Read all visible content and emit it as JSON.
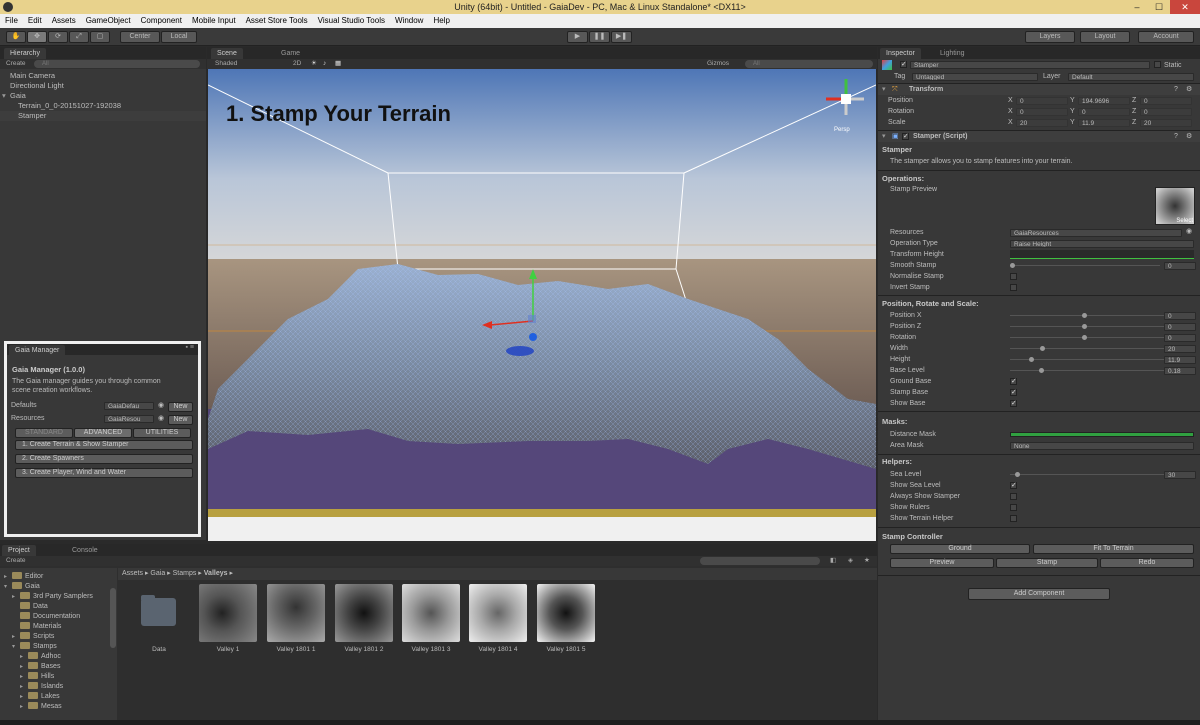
{
  "window": {
    "title": "Unity (64bit) - Untitled - GaiaDev - PC, Mac & Linux Standalone* <DX11>",
    "min": "–",
    "max": "☐",
    "close": "✕"
  },
  "menu": [
    "File",
    "Edit",
    "Assets",
    "GameObject",
    "Component",
    "Mobile Input",
    "Asset Store Tools",
    "Visual Studio Tools",
    "Window",
    "Help"
  ],
  "toolbar": {
    "center": "Center",
    "local": "Local",
    "layers": "Layers",
    "layout": "Layout",
    "account": "Account",
    "play": "▶",
    "pause": "❚❚",
    "step": "▶❚"
  },
  "hierarchy": {
    "tab": "Hierarchy",
    "create": "Create",
    "search": "All",
    "items": [
      {
        "label": "Main Camera",
        "indent": 0
      },
      {
        "label": "Directional Light",
        "indent": 0
      },
      {
        "label": "Gaia",
        "indent": 0,
        "arrow": "▾"
      },
      {
        "label": "Terrain_0_0-20151027-192038",
        "indent": 1
      },
      {
        "label": "Stamper",
        "indent": 1,
        "selected": true
      }
    ]
  },
  "gaia_manager": {
    "tab": "Gaia Manager",
    "heading": "Gaia Manager (1.0.0)",
    "desc1": "The Gaia manager guides you through common",
    "desc2": "scene creation workflows.",
    "defaults_label": "Defaults",
    "defaults_value": "GaiaDefau",
    "resources_label": "Resources",
    "resources_value": "GaiaResou",
    "new": "New",
    "tabs": [
      "STANDARD",
      "ADVANCED",
      "UTILITIES"
    ],
    "buttons": [
      "1. Create Terrain & Show Stamper",
      "2. Create Spawners",
      "3. Create Player, Wind and Water"
    ]
  },
  "scene": {
    "tab_scene": "Scene",
    "tab_game": "Game",
    "shaded": "Shaded",
    "twod": "2D",
    "gizmos": "Gizmos",
    "search": "All",
    "overlay_title": "1. Stamp Your  Terrain",
    "persp": "Persp"
  },
  "inspector": {
    "tab": "Inspector",
    "tab_lighting": "Lighting",
    "object_name": "Stamper",
    "static": "Static",
    "tag_label": "Tag",
    "tag_value": "Untagged",
    "layer_label": "Layer",
    "layer_value": "Default",
    "transform": {
      "title": "Transform",
      "position": {
        "label": "Position",
        "x": "0",
        "y": "194.9696",
        "z": "0"
      },
      "rotation": {
        "label": "Rotation",
        "x": "0",
        "y": "0",
        "z": "0"
      },
      "scale": {
        "label": "Scale",
        "x": "20",
        "y": "11.9",
        "z": "20"
      }
    },
    "stamper": {
      "title": "Stamper (Script)",
      "header": "Stamper",
      "desc": "The stamper allows you to stamp features into your terrain.",
      "operations": "Operations:",
      "stamp_preview": "Stamp Preview",
      "select": "Select",
      "resources_label": "Resources",
      "resources_value": "GaiaResources",
      "operation_type_label": "Operation Type",
      "operation_type_value": "Raise Height",
      "transform_height": "Transform Height",
      "smooth_stamp": "Smooth Stamp",
      "smooth_value": "0",
      "normalise_stamp": "Normalise Stamp",
      "invert_stamp": "Invert Stamp",
      "prs_header": "Position, Rotate and Scale:",
      "position_x": {
        "label": "Position X",
        "value": "0"
      },
      "position_z": {
        "label": "Position Z",
        "value": "0"
      },
      "rotation": {
        "label": "Rotation",
        "value": "0"
      },
      "width": {
        "label": "Width",
        "value": "20"
      },
      "height": {
        "label": "Height",
        "value": "11.9"
      },
      "base_level": {
        "label": "Base Level",
        "value": "0.18"
      },
      "ground_base": "Ground Base",
      "stamp_base": "Stamp Base",
      "show_base": "Show Base",
      "masks_header": "Masks:",
      "distance_mask": "Distance Mask",
      "area_mask": "Area Mask",
      "area_mask_value": "None",
      "helpers_header": "Helpers:",
      "sea_level": {
        "label": "Sea Level",
        "value": "30"
      },
      "show_sea_level": "Show Sea Level",
      "always_show_stamper": "Always Show Stamper",
      "show_rulers": "Show Rulers",
      "show_terrain_helper": "Show Terrain Helper",
      "controller_header": "Stamp Controller",
      "ground": "Ground",
      "fit_to_terrain": "Fit To Terrain",
      "preview": "Preview",
      "stamp": "Stamp",
      "redo": "Redo"
    },
    "add_component": "Add Component"
  },
  "project": {
    "tab": "Project",
    "tab_console": "Console",
    "create": "Create",
    "breadcrumb": [
      "Assets",
      "Gaia",
      "Stamps",
      "Valleys"
    ],
    "tree": [
      {
        "label": "Editor",
        "indent": 1,
        "arrow": "▸"
      },
      {
        "label": "Gaia",
        "indent": 1,
        "arrow": "▾"
      },
      {
        "label": "3rd Party Samplers",
        "indent": 2,
        "arrow": "▸"
      },
      {
        "label": "Data",
        "indent": 2,
        "arrow": ""
      },
      {
        "label": "Documentation",
        "indent": 2,
        "arrow": ""
      },
      {
        "label": "Materials",
        "indent": 2,
        "arrow": ""
      },
      {
        "label": "Scripts",
        "indent": 2,
        "arrow": "▸"
      },
      {
        "label": "Stamps",
        "indent": 2,
        "arrow": "▾"
      },
      {
        "label": "Adhoc",
        "indent": 3,
        "arrow": "▸"
      },
      {
        "label": "Bases",
        "indent": 3,
        "arrow": "▸"
      },
      {
        "label": "Hills",
        "indent": 3,
        "arrow": "▸"
      },
      {
        "label": "Islands",
        "indent": 3,
        "arrow": "▸"
      },
      {
        "label": "Lakes",
        "indent": 3,
        "arrow": "▸"
      },
      {
        "label": "Mesas",
        "indent": 3,
        "arrow": "▸"
      }
    ],
    "assets": [
      "Data",
      "Valley 1",
      "Valley 1801 1",
      "Valley 1801 2",
      "Valley 1801 3",
      "Valley 1801 4",
      "Valley 1801 5"
    ]
  }
}
